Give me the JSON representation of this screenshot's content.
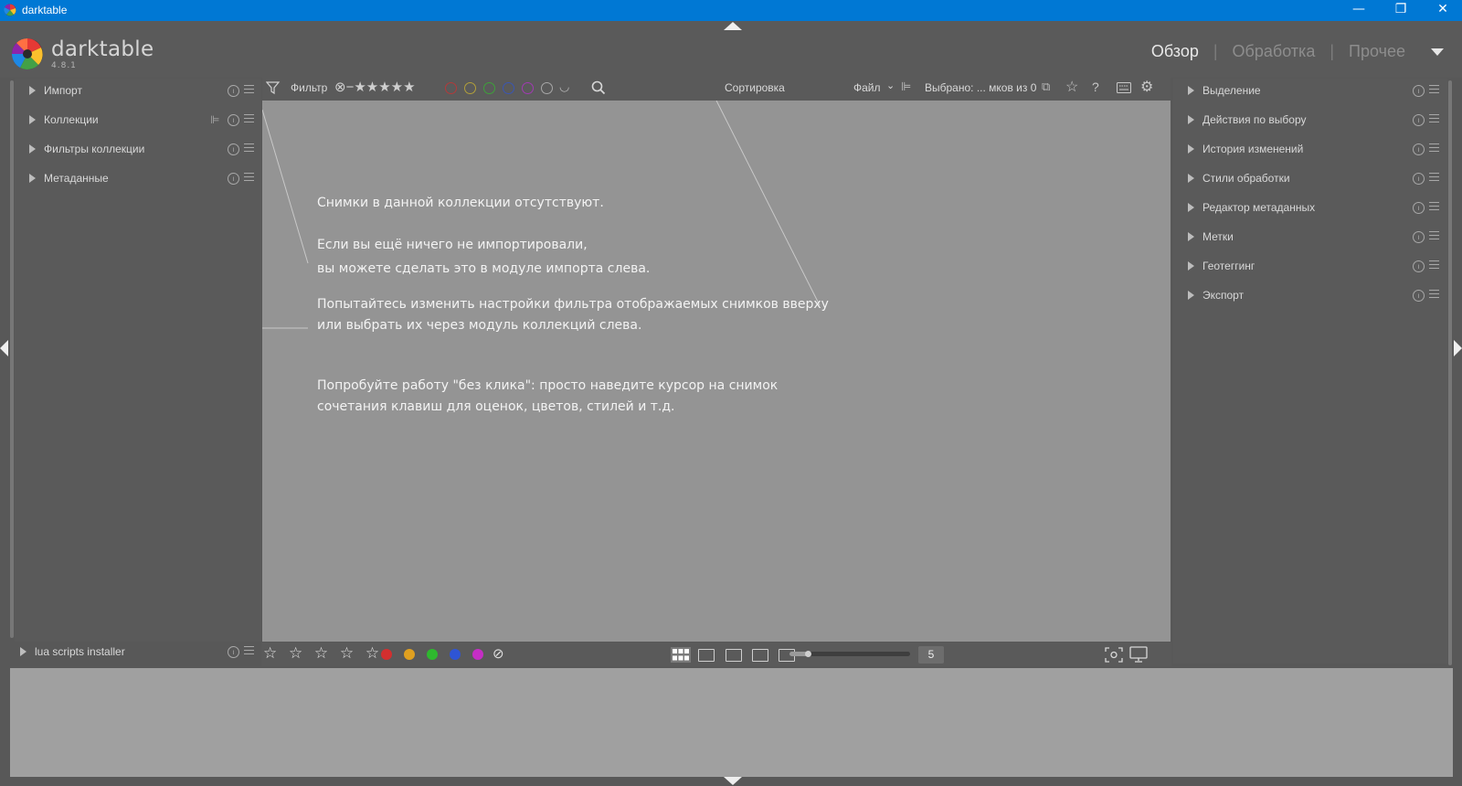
{
  "window": {
    "title": "darktable",
    "minimize": "—",
    "maximize": "❐",
    "close": "✕"
  },
  "header": {
    "app_name": "darktable",
    "version": "4.8.1",
    "views": [
      "Обзор",
      "Обработка",
      "Прочее"
    ],
    "active_view": "Обзор",
    "separator": "|"
  },
  "left_panel": {
    "modules": [
      {
        "label": "Импорт"
      },
      {
        "label": "Коллекции"
      },
      {
        "label": "Фильтры коллекции"
      },
      {
        "label": "Метаданные"
      }
    ],
    "bottom_module": {
      "label": "lua scripts installer"
    }
  },
  "right_panel": {
    "modules": [
      {
        "label": "Выделение"
      },
      {
        "label": "Действия по выбору"
      },
      {
        "label": "История изменений"
      },
      {
        "label": "Стили обработки"
      },
      {
        "label": "Редактор метаданных"
      },
      {
        "label": "Метки"
      },
      {
        "label": "Геотеггинг"
      },
      {
        "label": "Экспорт"
      }
    ]
  },
  "topbar": {
    "filter_label": "Фильтр",
    "rating_stars": "⊗−★★★★★",
    "sort_label": "Сортировка",
    "sort_value": "Файл",
    "selected_text": "Выбрано: ... мков из 0"
  },
  "color_filters": [
    "#b33a3a",
    "#b3a03a",
    "#3ea13a",
    "#3a56b3",
    "#a13ab3",
    "#a8a8a8"
  ],
  "center_messages": {
    "line1": "Снимки в данной коллекции отсутствуют.",
    "line2": "Если вы ещё ничего не импортировали,\nвы можете сделать это в модуле импорта слева.",
    "line3": "Попытайтесь изменить настройки фильтра отображаемых снимков вверху\nили выбрать их через модуль коллекций слева.",
    "line4": "Попробуйте работу \"без клика\": просто наведите курсор на снимок\nсочетания клавиш для оценок, цветов, стилей и т.д."
  },
  "bottombar": {
    "rating_stars": "☆ ☆ ☆ ☆ ☆",
    "color_labels": [
      "#d32f2f",
      "#e0a020",
      "#2eb82e",
      "#2f55d4",
      "#c52ec5"
    ],
    "zoom_value": "5",
    "zoom_fraction": 0.15
  }
}
